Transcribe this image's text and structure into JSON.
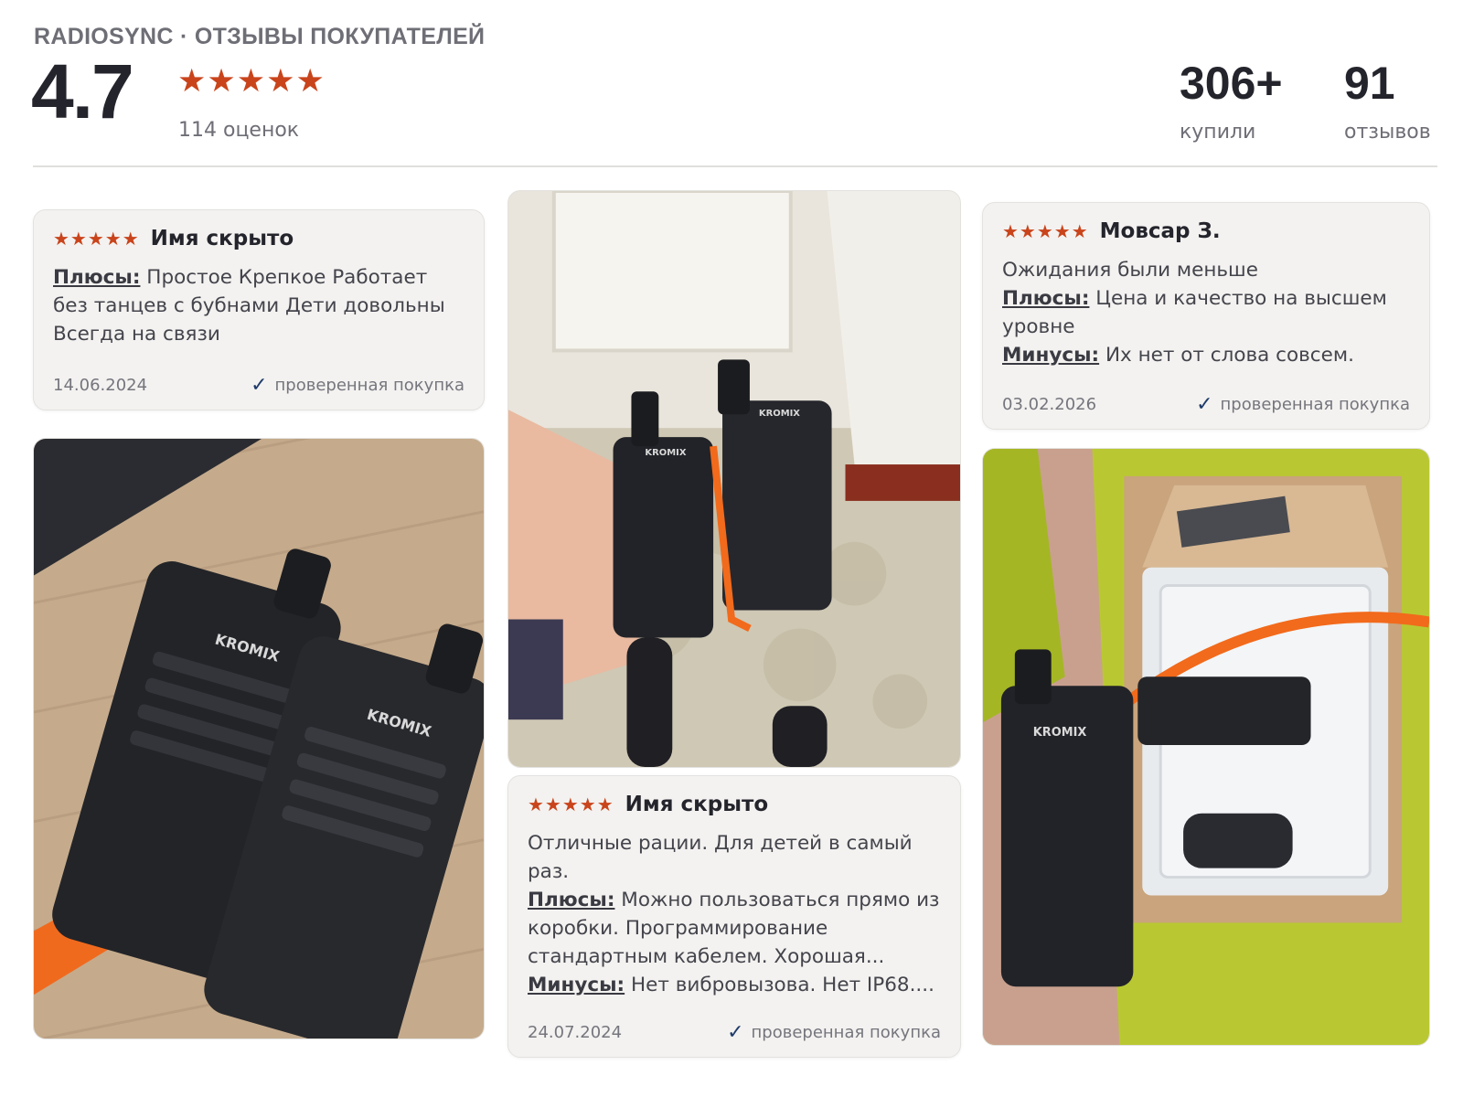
{
  "header": {
    "brand": "RADIOSYNC · ОТЗЫВЫ ПОКУПАТЕЛЕЙ",
    "rating": "4.7",
    "stars": "★★★★★",
    "rating_count": "114 оценок",
    "bought_num": "306+",
    "bought_label": "купили",
    "reviews_num": "91",
    "reviews_label": "отзывов"
  },
  "reviews": [
    {
      "stars": "★★★★★",
      "name": "Имя скрыто",
      "pros_label": "Плюсы:",
      "pros": "Простое Крепкое Работает без танцев с бубнами Дети довольны Всегда на связи",
      "date": "14.06.2024",
      "verified": "проверенная покупка"
    },
    {
      "stars": "★★★★★",
      "name": "Имя скрыто",
      "text": "Отличные рации. Для детей в самый раз.",
      "pros_label": "Плюсы:",
      "pros": "Можно пользоваться прямо из коробки. Программирование стандартным кабелем. Хорошая...",
      "cons_label": "Минусы:",
      "cons": "Нет вибровызова. Нет IP68....",
      "date": "24.07.2024",
      "verified": "проверенная покупка"
    },
    {
      "stars": "★★★★★",
      "name": "Мовсар З.",
      "text": "Ожидания были меньше",
      "pros_label": "Плюсы:",
      "pros": "Цена и качество на высшем уровне",
      "cons_label": "Минусы:",
      "cons": "Их нет от слова совсем.",
      "date": "03.02.2026",
      "verified": "проверенная покупка"
    }
  ],
  "photos": {
    "brand_print": "KROMIX",
    "accent_strap": "#f26a1b",
    "icons": [
      "check-icon",
      "star-icon"
    ]
  }
}
